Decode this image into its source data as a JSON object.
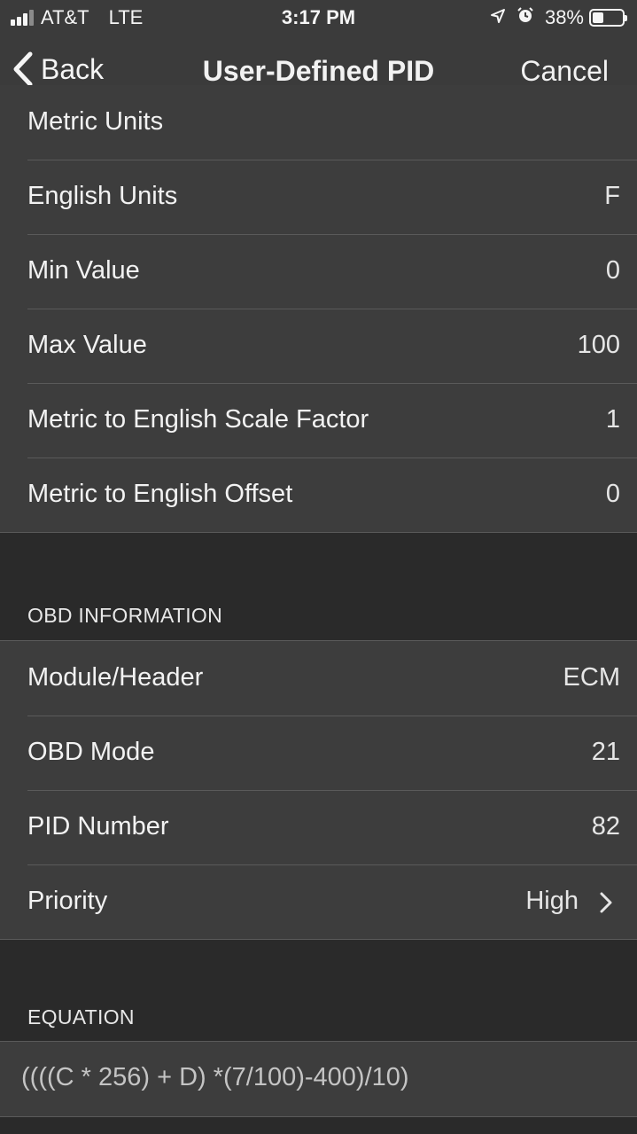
{
  "status_bar": {
    "carrier": "AT&T",
    "network": "LTE",
    "time": "3:17 PM",
    "battery_percent": "38%",
    "battery_level": 0.38,
    "icons": [
      "signal-icon",
      "location-arrow-icon",
      "alarm-icon",
      "battery-icon"
    ]
  },
  "nav": {
    "back_label": "Back",
    "title": "User-Defined PID",
    "cancel_label": "Cancel"
  },
  "units_group": {
    "rows": [
      {
        "label": "Metric Units",
        "value": ""
      },
      {
        "label": "English Units",
        "value": "F"
      },
      {
        "label": "Min Value",
        "value": "0"
      },
      {
        "label": "Max Value",
        "value": "100"
      },
      {
        "label": "Metric to English Scale Factor",
        "value": "1"
      },
      {
        "label": "Metric to English Offset",
        "value": "0"
      }
    ]
  },
  "obd_group": {
    "header": "OBD INFORMATION",
    "rows": [
      {
        "label": "Module/Header",
        "value": "ECM"
      },
      {
        "label": "OBD Mode",
        "value": "21"
      },
      {
        "label": "PID Number",
        "value": "82"
      },
      {
        "label": "Priority",
        "value": "High"
      }
    ]
  },
  "equation_group": {
    "header": "EQUATION",
    "value": "((((C * 256) + D) *(7/100)-400)/10)"
  },
  "colors": {
    "background": "#2a2a2a",
    "cell": "#3d3d3d",
    "bar": "#3b3b3b",
    "separator": "#5a5a5a",
    "text": "#f2f2f2"
  }
}
